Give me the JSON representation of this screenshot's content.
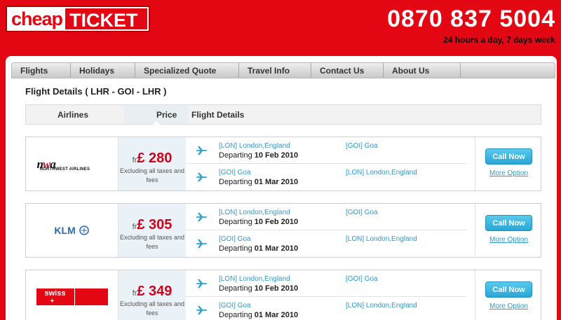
{
  "header": {
    "logo_cheap": "cheap",
    "logo_ticket": "TICKET",
    "phone": "0870 837 5004",
    "hours": "24 hours a day, 7 days week"
  },
  "nav": {
    "items": [
      "Flights",
      "Holidays",
      "Specialized Quote",
      "Travel Info",
      "Contact Us",
      "About Us"
    ]
  },
  "section_title": "Flight Details ( LHR - GOI - LHR )",
  "columns": {
    "airlines": "Airlines",
    "price": "Price",
    "details": "Flight Details"
  },
  "results": [
    {
      "airline": "Northwest Airlines",
      "logo_text": "nwa",
      "logo_sub": "NORTHWEST AIRLINES",
      "price_prefix": "fr",
      "price": "£ 280",
      "price_note": "Excluding all taxes and fees",
      "outbound": {
        "from": "[LON] London,England",
        "to": "[GOI] Goa",
        "departing_label": "Departing",
        "date": "10 Feb 2010"
      },
      "inbound": {
        "from": "[GOI] Goa",
        "to": "[LON] London,England",
        "departing_label": "Departing",
        "date": "01 Mar 2010"
      },
      "call_label": "Call Now",
      "more_label": "More Option"
    },
    {
      "airline": "KLM",
      "logo_text": "KLM",
      "price_prefix": "fr",
      "price": "£ 305",
      "price_note": "Excluding all taxes and fees",
      "outbound": {
        "from": "[LON] London,England",
        "to": "[GOI] Goa",
        "departing_label": "Departing",
        "date": "10 Feb 2010"
      },
      "inbound": {
        "from": "[GOI] Goa",
        "to": "[LON] London,England",
        "departing_label": "Departing",
        "date": "01 Mar 2010"
      },
      "call_label": "Call Now",
      "more_label": "More Option"
    },
    {
      "airline": "Swiss",
      "logo_text": "swiss",
      "price_prefix": "fr",
      "price": "£ 349",
      "price_note": "Excluding all taxes and fees",
      "outbound": {
        "from": "[LON] London,England",
        "to": "[GOI] Goa",
        "departing_label": "Departing",
        "date": "10 Feb 2010"
      },
      "inbound": {
        "from": "[GOI] Goa",
        "to": "[LON] London,England",
        "departing_label": "Departing",
        "date": "01 Mar 2010"
      },
      "call_label": "Call Now",
      "more_label": "More Option"
    }
  ],
  "colors": {
    "brand_red": "#e30613",
    "link_blue": "#3399cc",
    "price_red": "#d0021b",
    "button_blue": "#2aa6d6"
  },
  "icons": {
    "leg_icon": "plane-icon"
  }
}
